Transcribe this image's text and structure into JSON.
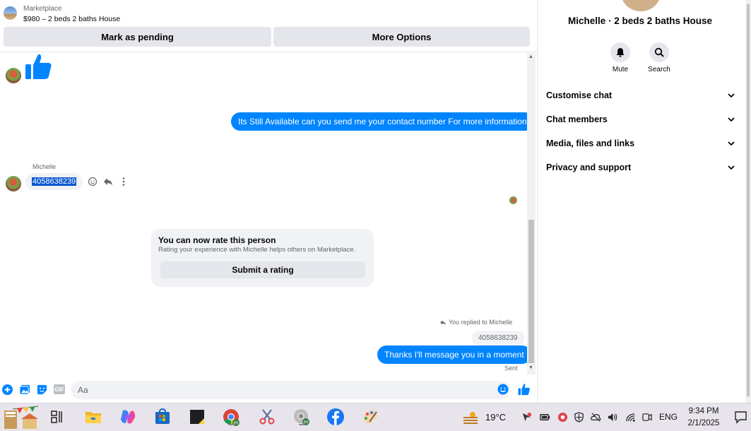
{
  "topbar": {
    "listing_source": "Marketplace",
    "listing_title": "$980 – 2 beds 2 baths House",
    "mark_pending_label": "Mark as pending",
    "more_options_label": "More Options"
  },
  "messages": {
    "outgoing_1": "Its Still Available can you send me your contact number For more information",
    "sender_name": "Michelle",
    "incoming_phone": "4058638239",
    "rating_card": {
      "title": "You can now rate this person",
      "subtitle": "Rating your experience with Michelle helps others on Marketplace.",
      "button": "Submit a rating"
    },
    "reply_note": "You replied to Michelle",
    "quoted_text": "4058638239",
    "outgoing_2": "Thanks I'll message you in a moment",
    "status": "Sent"
  },
  "composer": {
    "placeholder": "Aa",
    "gif_label": "GIF"
  },
  "info": {
    "name": "Michelle · 2 beds 2 baths House",
    "mute_label": "Mute",
    "search_label": "Search",
    "sections": [
      "Customise chat",
      "Chat members",
      "Media, files and links",
      "Privacy and support"
    ]
  },
  "taskbar": {
    "temperature": "19°C",
    "language": "ENG",
    "time": "9:34 PM",
    "date": "2/1/2025"
  },
  "colors": {
    "accent": "#0084ff",
    "bubble_gray": "#f0f2f5",
    "button_gray": "#e4e6eb",
    "secondary_text": "#65676b"
  }
}
